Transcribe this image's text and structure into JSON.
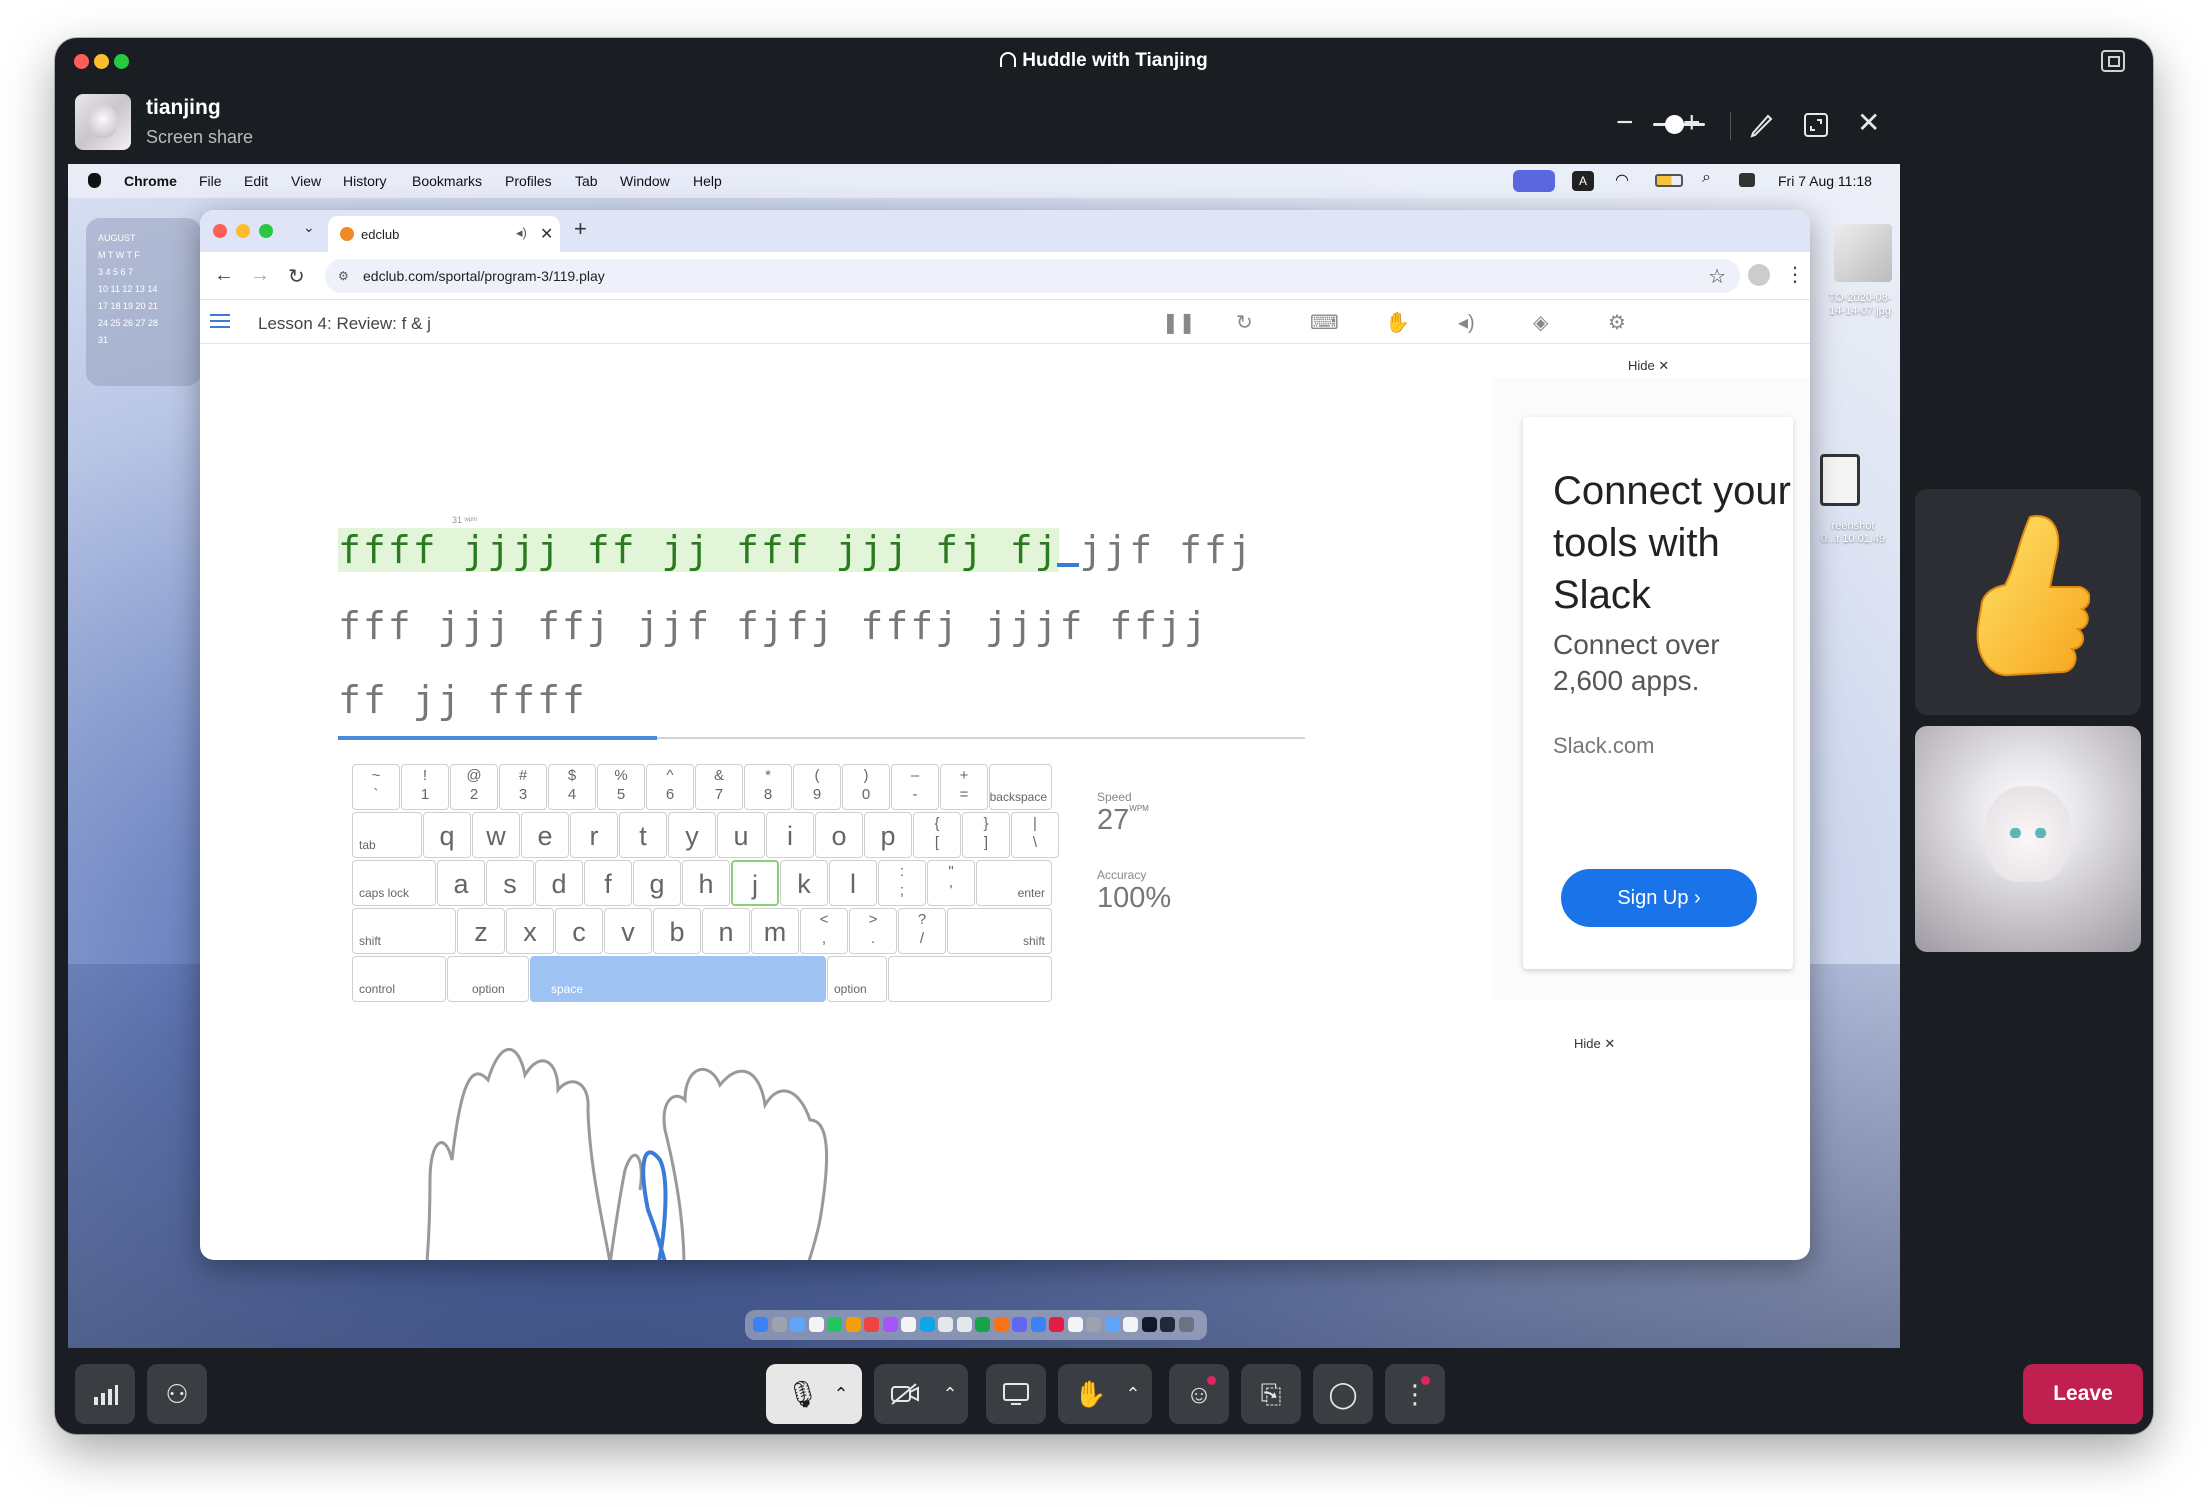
{
  "huddle": {
    "title": "Huddle with Tianjing",
    "sharer_name": "tianjing",
    "sharer_subtitle": "Screen share",
    "leave_label": "Leave"
  },
  "mac_menubar": {
    "app": "Chrome",
    "items": [
      "File",
      "Edit",
      "View",
      "History",
      "Bookmarks",
      "Profiles",
      "Tab",
      "Window",
      "Help"
    ],
    "clock": "Fri 7 Aug  11:18"
  },
  "calendar_widget": {
    "month": "AUGUST",
    "weekdays": "M  T  W  T  F",
    "rows": [
      "3  4  5  6  7",
      "10  11  12  13  14",
      "17  18  19  20  21",
      "24  25  26  27  28",
      "31"
    ]
  },
  "desktop": {
    "file_label_1": "TO-2020-08-\n14-14-07.jpg",
    "file_label_2": "reenshot\n0...t 10.01.49"
  },
  "browser": {
    "tab_title": "edclub",
    "url": "edclub.com/sportal/program-3/119.play"
  },
  "lesson": {
    "title": "Lesson 4: Review: f & j",
    "wpm_marker": "31 ʷᵖᵐ",
    "line1_typed": "ffff jjjj ff jj fff jjj fj f",
    "line1_current": "j",
    "line1_rest": "jjf ffj",
    "line2": "fff jjj ffj jjf fjfj fffj jjjf ffjj",
    "line3": "ff jj ffff",
    "progress_fraction": 0.33,
    "speed_label": "Speed",
    "speed_value": "27",
    "speed_unit": "WPM",
    "accuracy_label": "Accuracy",
    "accuracy_value": "100%"
  },
  "keyboard": {
    "number_row": [
      {
        "up": "~",
        "lo": "`"
      },
      {
        "up": "!",
        "lo": "1"
      },
      {
        "up": "@",
        "lo": "2"
      },
      {
        "up": "#",
        "lo": "3"
      },
      {
        "up": "$",
        "lo": "4"
      },
      {
        "up": "%",
        "lo": "5"
      },
      {
        "up": "^",
        "lo": "6"
      },
      {
        "up": "&",
        "lo": "7"
      },
      {
        "up": "*",
        "lo": "8"
      },
      {
        "up": "(",
        "lo": "9"
      },
      {
        "up": ")",
        "lo": "0"
      },
      {
        "up": "–",
        "lo": "-"
      },
      {
        "up": "+",
        "lo": "="
      }
    ],
    "backspace": "backspace",
    "tab": "tab",
    "top_row": [
      "q",
      "w",
      "e",
      "r",
      "t",
      "y",
      "u",
      "i",
      "o",
      "p"
    ],
    "top_row_sym": [
      {
        "up": "{",
        "lo": "["
      },
      {
        "up": "}",
        "lo": "]"
      },
      {
        "up": "|",
        "lo": "\\"
      }
    ],
    "caps": "caps lock",
    "home_row": [
      "a",
      "s",
      "d",
      "f",
      "g",
      "h",
      "j",
      "k",
      "l"
    ],
    "home_row_sym": [
      {
        "up": ":",
        "lo": ";"
      },
      {
        "up": "\"",
        "lo": "'"
      }
    ],
    "enter": "enter",
    "shift": "shift",
    "bottom_row": [
      "z",
      "x",
      "c",
      "v",
      "b",
      "n",
      "m"
    ],
    "bottom_row_sym": [
      {
        "up": "<",
        "lo": ","
      },
      {
        "up": ">",
        "lo": "."
      },
      {
        "up": "?",
        "lo": "/"
      }
    ],
    "control": "control",
    "option": "option",
    "space": "space",
    "highlight_key": "j"
  },
  "ad": {
    "hide_label": "Hide ✕",
    "headline": "Connect your tools with Slack",
    "subline": "Connect over 2,600 apps.",
    "domain": "Slack.com",
    "cta": "Sign Up"
  },
  "icons": {
    "thumbs_up": "thumbs-up-emoji"
  },
  "colors": {
    "leave": "#c0204f",
    "typed_bg": "#e3f5d8",
    "typed_fg": "#2a7a20",
    "space_key": "#9ec3f3",
    "ad_button": "#1a73e8"
  }
}
